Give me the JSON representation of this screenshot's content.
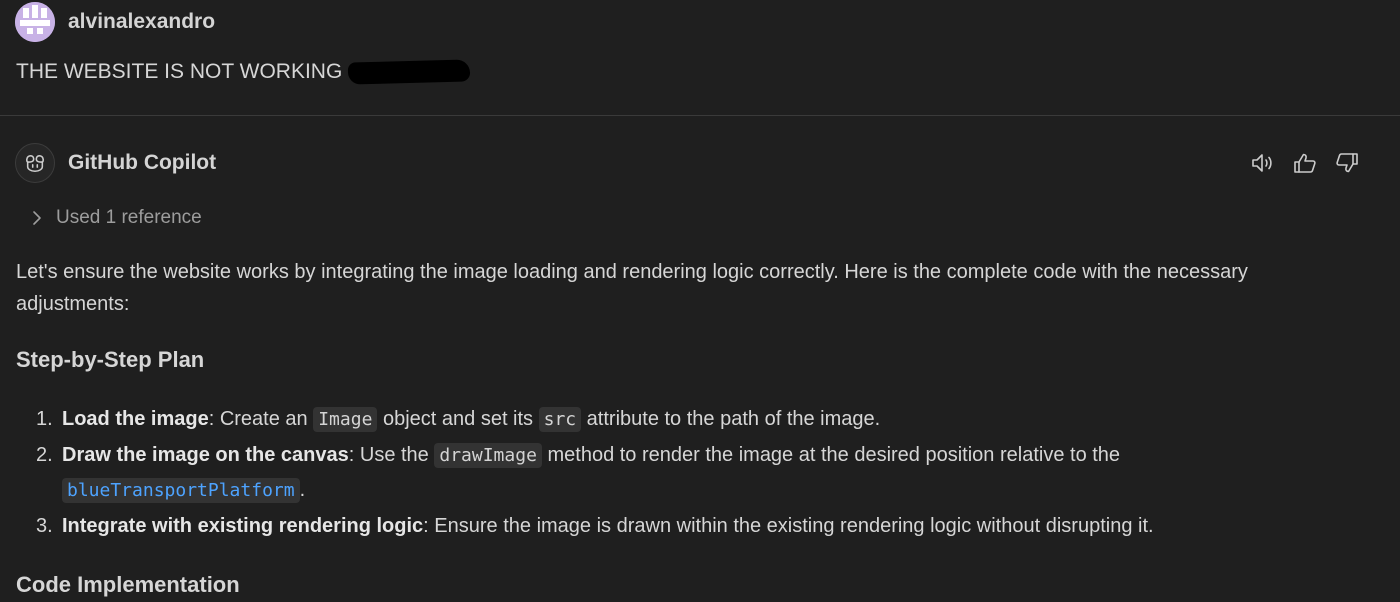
{
  "user": {
    "name": "alvinalexandro",
    "message": "THE WEBSITE IS NOT WORKING",
    "avatar_color": "#c8b2e6"
  },
  "assistant": {
    "name": "GitHub Copilot",
    "actions": [
      {
        "icon": "speaker-icon"
      },
      {
        "icon": "thumbs-up-icon"
      },
      {
        "icon": "thumbs-down-icon"
      }
    ],
    "reference_label": "Used 1 reference",
    "intro": "Let's ensure the website works by integrating the image loading and rendering logic correctly. Here is the complete code with the necessary adjustments:",
    "plan_heading": "Step-by-Step Plan",
    "steps": [
      {
        "num": "1.",
        "title": "Load the image",
        "p1": ": Create an ",
        "code1": "Image",
        "p2": " object and set its ",
        "code2": "src",
        "p3": " attribute to the path of the image."
      },
      {
        "num": "2.",
        "title": "Draw the image on the canvas",
        "p1": ": Use the ",
        "code1": "drawImage",
        "p2": " method to render the image at the desired position relative to the ",
        "code2": "blueTransportPlatform",
        "p3": "."
      },
      {
        "num": "3.",
        "title": "Integrate with existing rendering logic",
        "p1": ": Ensure the image is drawn within the existing rendering logic without disrupting it."
      }
    ],
    "code_heading": "Code Implementation"
  },
  "colors": {
    "background": "#1f1f1f",
    "text": "#d6d6d6",
    "muted": "#9d9d9d",
    "link": "#4da3ff",
    "code_bg": "#333333",
    "divider": "#3a3a3a"
  }
}
